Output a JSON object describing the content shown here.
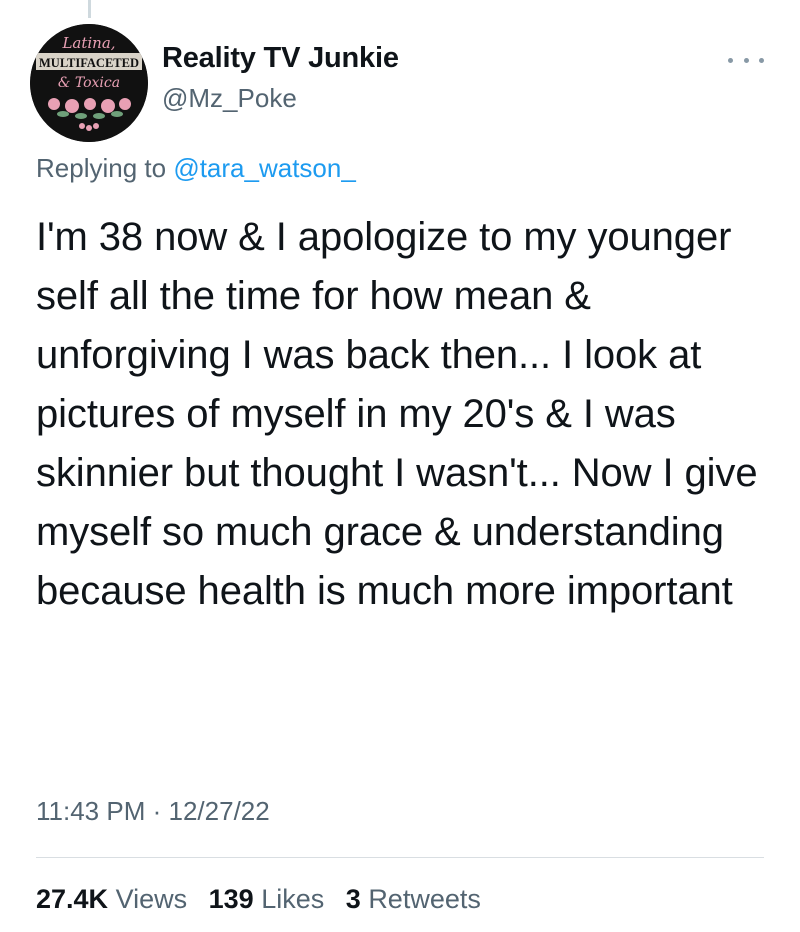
{
  "tweet": {
    "display_name": "Reality TV Junkie",
    "handle": "@Mz_Poke",
    "replying_prefix": "Replying to",
    "replying_to": "@tara_watson_",
    "text": "I'm 38 now & I apologize to my younger self all the time for how mean & unforgiving I was back then... I look at pictures of myself in my 20's & I was skinnier but thought I wasn't... Now I give myself so much grace & understanding because health is much more important",
    "time": "11:43 PM",
    "separator": "·",
    "date": "12/27/22",
    "stats": {
      "views_count": "27.4K",
      "views_label": "Views",
      "likes_count": "139",
      "likes_label": "Likes",
      "retweets_count": "3",
      "retweets_label": "Retweets"
    },
    "avatar_lettering": [
      "Latina,",
      "MULTIFACETED",
      "& Toxica"
    ]
  },
  "colors": {
    "text": "#0f1419",
    "secondary": "#536471",
    "link": "#1d9bf0",
    "divider": "#d9dee2",
    "avatar_bg": "#111111",
    "avatar_accent": "#e8a0b4"
  },
  "icons": {
    "more": "more-options-icon"
  }
}
